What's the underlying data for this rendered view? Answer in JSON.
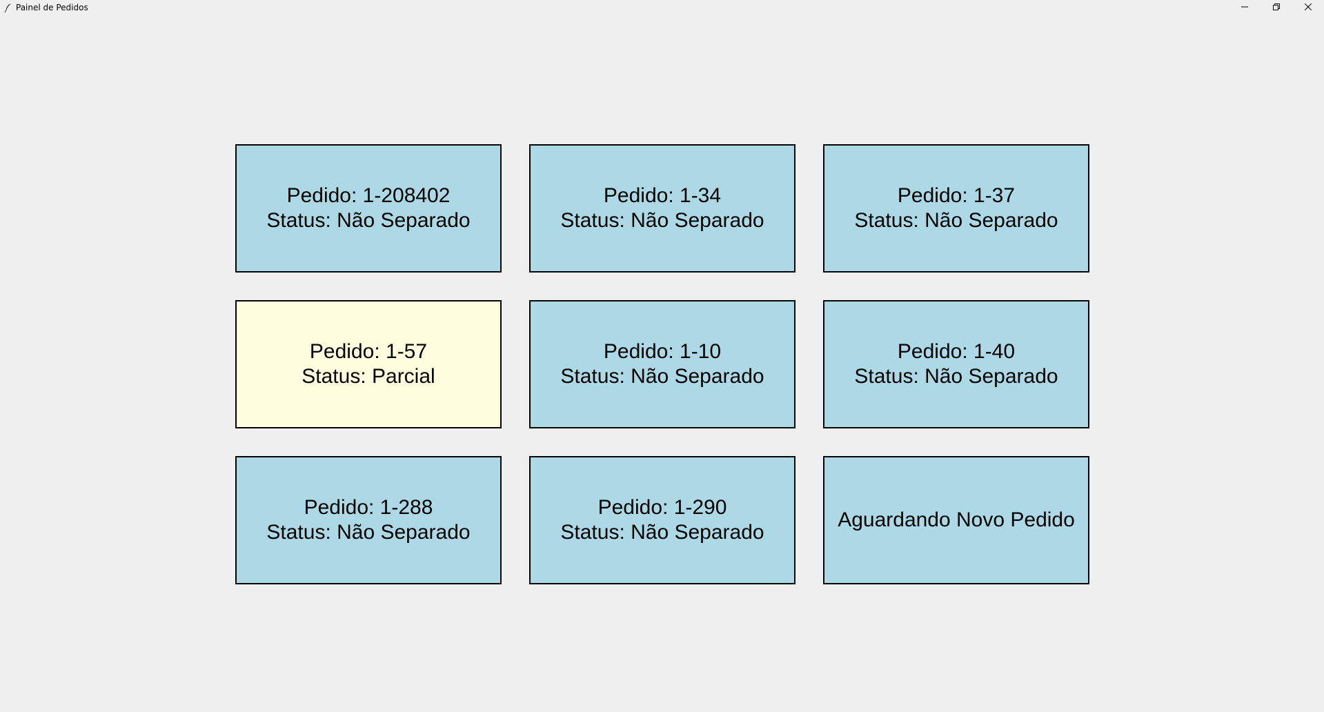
{
  "window": {
    "title": "Painel de Pedidos",
    "controls": [
      "minimize",
      "restore",
      "close"
    ]
  },
  "colors": {
    "not_separated": "#add8e6",
    "partial": "#ffffe0",
    "waiting": "#add8e6"
  },
  "orders": [
    {
      "line1": "Pedido: 1-208402",
      "line2": "Status: Não Separado",
      "state": "not_separated"
    },
    {
      "line1": "Pedido: 1-34",
      "line2": "Status: Não Separado",
      "state": "not_separated"
    },
    {
      "line1": "Pedido: 1-37",
      "line2": "Status: Não Separado",
      "state": "not_separated"
    },
    {
      "line1": "Pedido: 1-57",
      "line2": "Status: Parcial",
      "state": "partial"
    },
    {
      "line1": "Pedido: 1-10",
      "line2": "Status: Não Separado",
      "state": "not_separated"
    },
    {
      "line1": "Pedido: 1-40",
      "line2": "Status: Não Separado",
      "state": "not_separated"
    },
    {
      "line1": "Pedido: 1-288",
      "line2": "Status: Não Separado",
      "state": "not_separated"
    },
    {
      "line1": "Pedido: 1-290",
      "line2": "Status: Não Separado",
      "state": "not_separated"
    },
    {
      "line1": "Aguardando Novo Pedido",
      "line2": "",
      "state": "waiting"
    }
  ]
}
